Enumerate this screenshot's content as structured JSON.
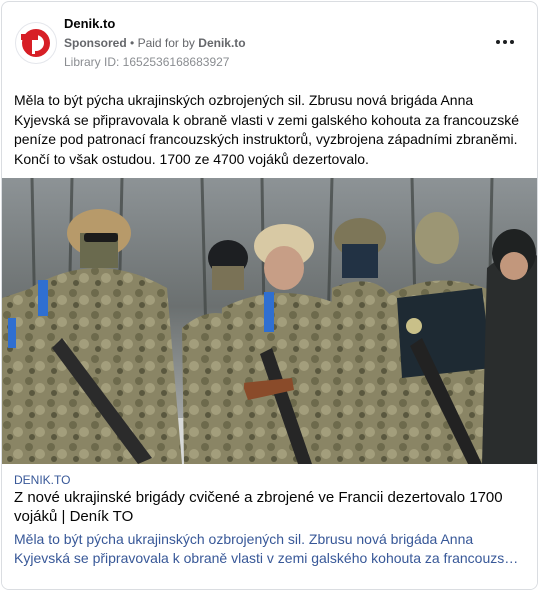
{
  "post": {
    "page_name": "Denik.to",
    "sponsored_label": "Sponsored",
    "separator": "•",
    "paid_for_label": "Paid for by",
    "payer": "Denik.to",
    "library_id": "Library ID: 1652536168683927",
    "avatar_logo_text": "TO",
    "ad_text": "Měla to být pýcha ukrajinských ozbrojených sil. Zbrusu nová brigáda Anna Kyjevská se připravovala k obraně vlasti v zemi galského kohouta za francouzské peníze pod patronací francouzských instruktorů, vyzbrojena západními zbraněmi. Končí to však ostudou. 1700 ze 4700 vojáků dezertovalo."
  },
  "link_preview": {
    "domain": "DENIK.TO",
    "headline": "Z nové ukrajinské brigády cvičené a zbrojené ve Francii dezertovalo 1700 vojáků | Deník TO",
    "description": "Měla to být pýcha ukrajinských ozbrojených sil. Zbrusu nová brigáda Anna Kyjevská se připravovala k obraně vlasti v zemi galského kohouta za francouzské peníze pod patronací francouzských instruktorů, vyzbrojena západními zbraněmi."
  },
  "icons": {
    "more": "more-options-icon",
    "logo": "denik-to-logo"
  },
  "colors": {
    "brand_red": "#d71f26",
    "link_blue": "#385898",
    "muted_gray": "#65676b",
    "border": "#dadde1"
  }
}
